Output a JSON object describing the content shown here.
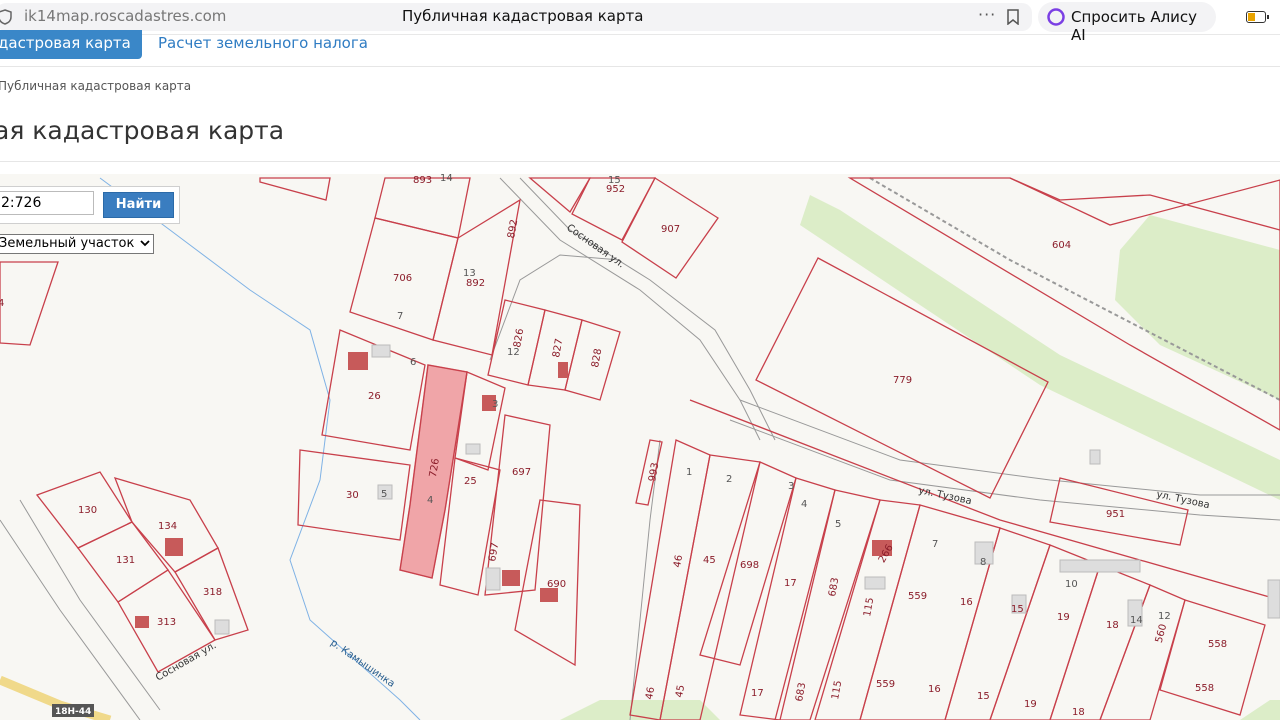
{
  "browser": {
    "url": "ik14map.roscadastres.com",
    "page_title": "Публичная кадастровая карта",
    "menu_dots": "···",
    "alice_label": "Спросить Алису AI"
  },
  "header": {
    "active_tab": "дастровая карта",
    "tab_land_tax": "Расчет земельного налога",
    "breadcrumb": "Публичная кадастровая карта",
    "heading": "ая кадастровая карта"
  },
  "search": {
    "value": "2:726",
    "button_label": "Найти",
    "type_selected": "Земельный участок"
  },
  "map": {
    "colors": {
      "parcel": "#c8404b",
      "highlight": "#f0a5a8",
      "building": "#c75a5a",
      "green": "#dcedc8",
      "water": "#7fb2e5"
    },
    "parcels": [
      "893",
      "14",
      "952",
      "15",
      "907",
      "604",
      "706",
      "13",
      "892",
      "892",
      "7",
      "826",
      "12",
      "827",
      "828",
      "779",
      "6",
      "26",
      "3",
      "726",
      "4",
      "25",
      "697",
      "993",
      "1",
      "2",
      "3",
      "4",
      "5",
      "951",
      "30",
      "5",
      "130",
      "134",
      "131",
      "313",
      "318",
      "46",
      "45",
      "698",
      "17",
      "683",
      "115",
      "266",
      "7",
      "559",
      "16",
      "8",
      "15",
      "10",
      "19",
      "18",
      "14",
      "12",
      "560",
      "558",
      "697",
      "690",
      "46",
      "45",
      "17",
      "683",
      "115",
      "559",
      "16",
      "15",
      "19",
      "18",
      "558",
      "4"
    ],
    "streets": {
      "sosnovaya_top": "Сосновая ул.",
      "tuzova_1": "ул. Тузова",
      "tuzova_2": "ул. Тузова",
      "sosnovaya_bottom": "Сосновая ул.",
      "river": "р. Камышинка",
      "road_number": "18Н-44"
    }
  }
}
